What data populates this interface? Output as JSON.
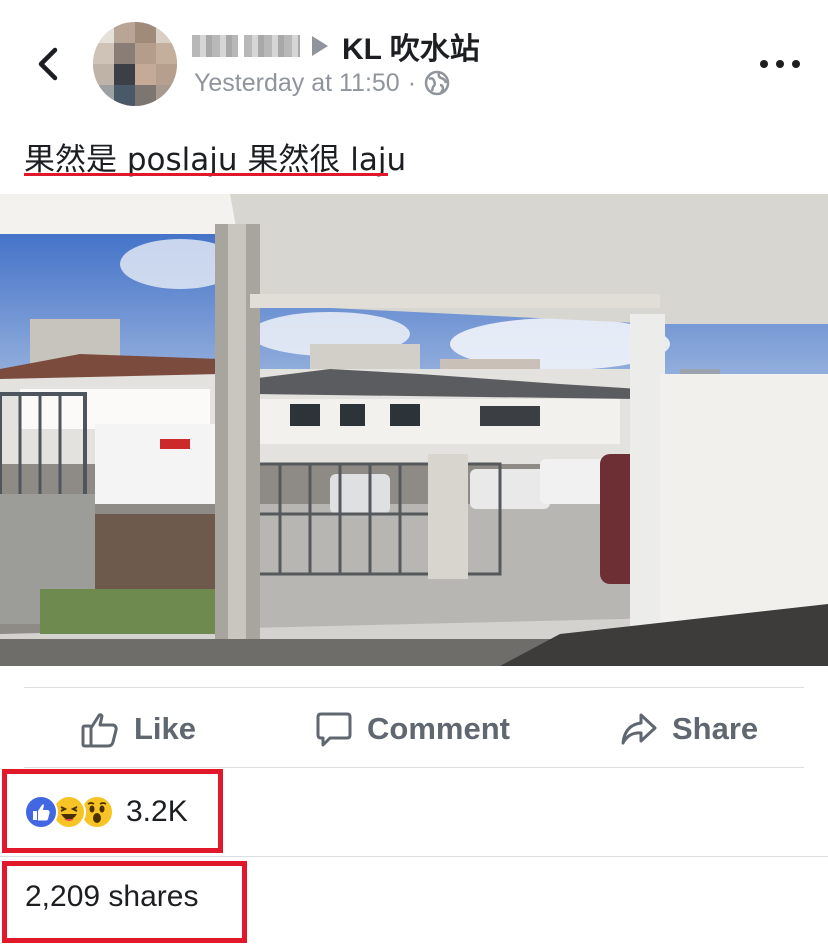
{
  "header": {
    "author_name": "",
    "group_name": "KL 吹水站",
    "timestamp": "Yesterday at 11:50",
    "separator": "·",
    "privacy_icon": "globe-icon",
    "back_icon": "chevron-left-icon",
    "more_icon": "more-horizontal-icon"
  },
  "post": {
    "caption": "果然是 poslaju 果然很 laju"
  },
  "video": {
    "mute_icon": "muted-speaker-icon"
  },
  "actions": {
    "like_label": "Like",
    "comment_label": "Comment",
    "share_label": "Share"
  },
  "stats": {
    "reactions": [
      "like",
      "haha",
      "wow"
    ],
    "reaction_count": "3.2K",
    "shares": "2,209 shares"
  },
  "colors": {
    "highlight_red": "#e0182a",
    "text_primary": "#1c1e21",
    "text_secondary": "#90949c",
    "action_gray": "#606770",
    "like_blue": "#4267e2",
    "emoji_yellow": "#f7c325"
  }
}
